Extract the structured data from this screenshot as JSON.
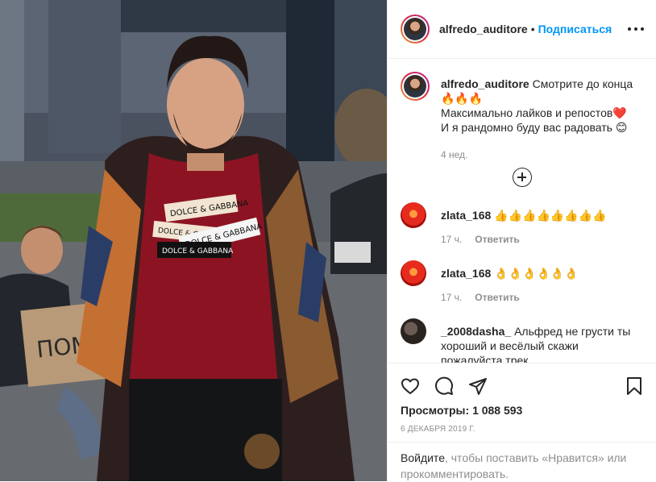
{
  "post": {
    "author": "alfredo_auditore",
    "dot": "•",
    "follow_label": "Подписаться",
    "more_label": "more options"
  },
  "caption": {
    "username": "alfredo_auditore",
    "line1": "Смотрите до конца",
    "line1_emoji": "🔥🔥🔥",
    "line2": "Максимально лайков и репостов❤️",
    "line3": "И я рандомно буду вас радовать 😊",
    "time": "4 нед."
  },
  "comments": [
    {
      "username": "zlata_168",
      "text": "👍👍👍👍👍👍👍👍",
      "time": "17 ч.",
      "reply": "Ответить"
    },
    {
      "username": "zlata_168",
      "text": "👌👌👌👌👌👌",
      "time": "17 ч.",
      "reply": "Ответить"
    },
    {
      "username": "_2008dasha_",
      "text": "Альфред не грусти ты хороший и весёлый скажи пожалуйста трек",
      "time": "",
      "reply": ""
    }
  ],
  "stats": {
    "views_label": "Просмотры:",
    "views_value": "1 088 593",
    "date": "6 ДЕКАБРЯ 2019 Г."
  },
  "login": {
    "link": "Войдите",
    "rest": ", чтобы поставить «Нравится» или прокомментировать."
  },
  "media": {
    "shirt_labels": [
      "DOLCE & GABBANA",
      "DOLCE & GABBANA",
      "DOLCE & GABBANA",
      "DOLCE & GABBANA"
    ],
    "sign_text": "ПОМОГ"
  },
  "colors": {
    "accent": "#0095f6",
    "text": "#262626",
    "muted": "#8e8e8e",
    "divider": "#efefef"
  },
  "icons": [
    "heart-icon",
    "comment-icon",
    "share-icon",
    "bookmark-icon",
    "more-icon",
    "plus-circle-icon"
  ]
}
